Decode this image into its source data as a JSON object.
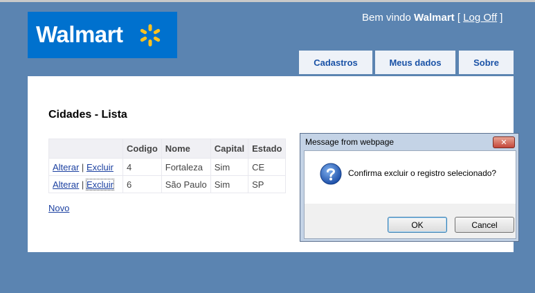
{
  "header": {
    "logo_text": "Walmart",
    "welcome_prefix": "Bem vindo",
    "user": "Walmart",
    "logoff_label": "Log Off",
    "bracket_open": "[",
    "bracket_close": "]"
  },
  "nav": {
    "tabs": [
      {
        "label": "Cadastros"
      },
      {
        "label": "Meus dados"
      },
      {
        "label": "Sobre"
      }
    ]
  },
  "page": {
    "title": "Cidades - Lista",
    "columns": [
      "",
      "Codigo",
      "Nome",
      "Capital",
      "Estado"
    ],
    "rows": [
      {
        "alterar": "Alterar",
        "sep": "|",
        "excluir": "Excluir",
        "codigo": "4",
        "nome": "Fortaleza",
        "capital": "Sim",
        "estado": "CE"
      },
      {
        "alterar": "Alterar",
        "sep": "|",
        "excluir": "Excluir",
        "codigo": "6",
        "nome": "São Paulo",
        "capital": "Sim",
        "estado": "SP"
      }
    ],
    "novo_label": "Novo"
  },
  "dialog": {
    "title": "Message from webpage",
    "close_glyph": "✕",
    "icon": "question-icon",
    "message": "Confirma excluir o registro selecionado?",
    "ok_label": "OK",
    "cancel_label": "Cancel"
  },
  "colors": {
    "background": "#5b84b1",
    "logo_blue": "#0071ce",
    "spark_yellow": "#ffc220",
    "link_blue": "#1a3fa0"
  }
}
